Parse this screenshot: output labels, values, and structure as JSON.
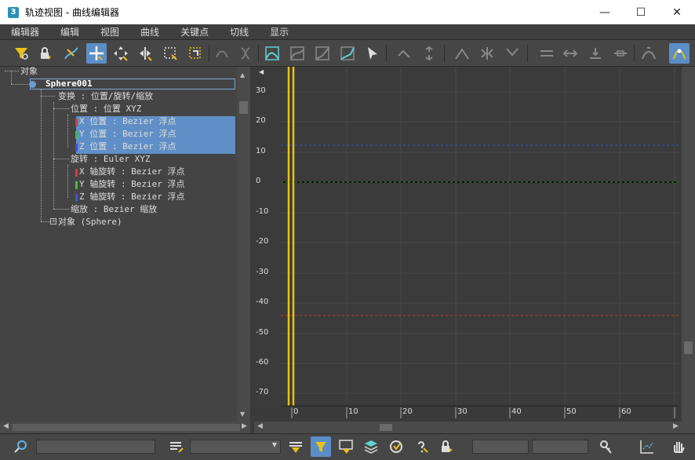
{
  "window": {
    "title": "轨迹视图 - 曲线编辑器",
    "app_icon_label": "3"
  },
  "menu": [
    "编辑器",
    "编辑",
    "视图",
    "曲线",
    "关键点",
    "切线",
    "显示"
  ],
  "tree": {
    "nodes": [
      {
        "label": "对象"
      },
      {
        "label": "Sphere001"
      },
      {
        "label": "变换 : 位置/旋转/缩放"
      },
      {
        "label": "位置 : 位置 XYZ"
      },
      {
        "label": "X 位置 : Bezier 浮点"
      },
      {
        "label": "Y 位置 : Bezier 浮点"
      },
      {
        "label": "Z 位置 : Bezier 浮点"
      },
      {
        "label": "旋转 : Euler XYZ"
      },
      {
        "label": "X 轴旋转 : Bezier 浮点"
      },
      {
        "label": "Y 轴旋转 : Bezier 浮点"
      },
      {
        "label": "Z 轴旋转 : Bezier 浮点"
      },
      {
        "label": "缩放 : Bezier 缩放"
      },
      {
        "label": "对象 (Sphere)"
      }
    ]
  },
  "graph": {
    "y_ticks": [
      "30",
      "20",
      "10",
      "0",
      "-10",
      "-20",
      "-30",
      "-40",
      "-50",
      "-60",
      "-70"
    ],
    "x_ticks": [
      "0",
      "10",
      "20",
      "30",
      "40",
      "50",
      "60"
    ]
  },
  "colors": {
    "accent": "#5b8ec6",
    "time_slider": "#e8c21a",
    "curve_x": "#c0392b",
    "curve_y": "#3aa03a",
    "curve_z": "#3a4ed0"
  }
}
